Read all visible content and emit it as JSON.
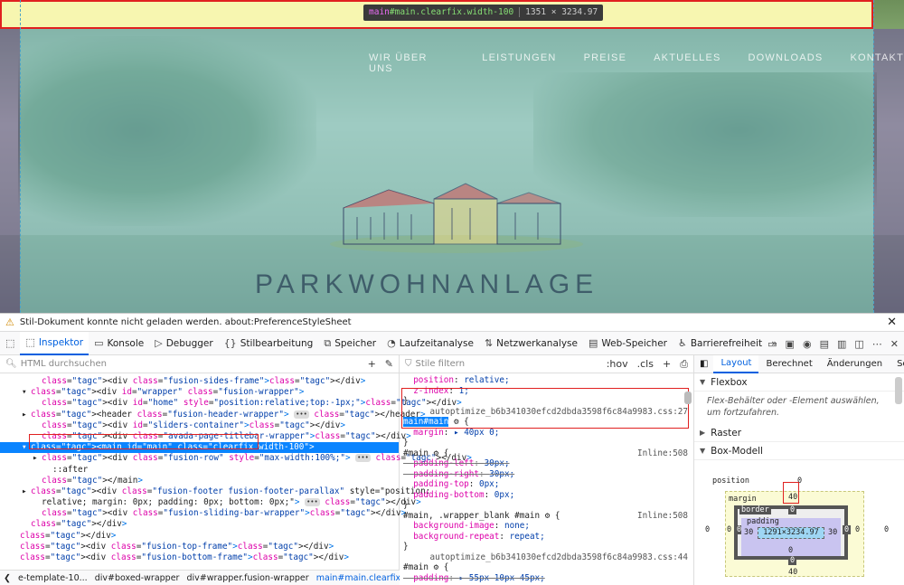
{
  "preview": {
    "tooltip": {
      "tag": "main",
      "selector": "#main.clearfix.width-100",
      "dims": "1351 × 3234.97"
    },
    "nav": [
      "WIR ÜBER UNS",
      "LEISTUNGEN",
      "PREISE",
      "AKTUELLES",
      "DOWNLOADS",
      "KONTAKT"
    ],
    "brand": "PARKWOHNANLAGE"
  },
  "notice": {
    "text": "Stil-Dokument konnte nicht geladen werden. about:PreferenceStyleSheet"
  },
  "toolbar": {
    "tabs": [
      {
        "label": "Inspektor",
        "icon": "inspector-icon"
      },
      {
        "label": "Konsole",
        "icon": "console-icon"
      },
      {
        "label": "Debugger",
        "icon": "debugger-icon"
      },
      {
        "label": "Stilbearbeitung",
        "icon": "style-editor-icon"
      },
      {
        "label": "Speicher",
        "icon": "memory-icon"
      },
      {
        "label": "Laufzeitanalyse",
        "icon": "performance-icon"
      },
      {
        "label": "Netzwerkanalyse",
        "icon": "network-icon"
      },
      {
        "label": "Web-Speicher",
        "icon": "storage-icon"
      },
      {
        "label": "Barrierefreiheit",
        "icon": "accessibility-icon"
      }
    ]
  },
  "markup": {
    "search_placeholder": "HTML durchsuchen",
    "lines": [
      {
        "indent": 2,
        "html": "<div class=\"fusion-sides-frame\"></div>"
      },
      {
        "indent": 1,
        "toggle": "▾",
        "html": "<div id=\"wrapper\" class=\"fusion-wrapper\">"
      },
      {
        "indent": 2,
        "html": "<div id=\"home\" style=\"position:relative;top:-1px;\"></div>"
      },
      {
        "indent": 1,
        "toggle": "▸",
        "html": "<header class=\"fusion-header-wrapper\"> ••• </header>"
      },
      {
        "indent": 2,
        "html": "<div id=\"sliders-container\"></div>"
      },
      {
        "indent": 2,
        "html": "<div class=\"avada-page-titlebar-wrapper\"></div>"
      },
      {
        "indent": 1,
        "toggle": "▾",
        "html": "<main id=\"main\" class=\"clearfix width-100\">",
        "selected": true
      },
      {
        "indent": 2,
        "toggle": "▸",
        "html": "<div class=\"fusion-row\" style=\"max-width:100%;\"> ••• </div>"
      },
      {
        "indent": 3,
        "html": "::after"
      },
      {
        "indent": 2,
        "html": "</main>"
      },
      {
        "indent": 1,
        "toggle": "▸",
        "html": "<div class=\"fusion-footer fusion-footer-parallax\" style=\"position:"
      },
      {
        "indent": 2,
        "html": "relative; margin: 0px; padding: 0px; bottom: 0px;\"> ••• </div>"
      },
      {
        "indent": 2,
        "html": "<div class=\"fusion-sliding-bar-wrapper\"></div>"
      },
      {
        "indent": 1,
        "html": "</div>"
      },
      {
        "indent": 0,
        "html": "</div>"
      },
      {
        "indent": 0,
        "html": "<div class=\"fusion-top-frame\"></div>"
      },
      {
        "indent": 0,
        "html": "<div class=\"fusion-bottom-frame\"></div>"
      }
    ],
    "breadcrumbs": [
      "e-template-10...",
      "div#boxed-wrapper",
      "div#wrapper.fusion-wrapper",
      "main#main.clearfix.width-100"
    ]
  },
  "rules": {
    "filter_placeholder": "Stile filtern",
    "hov": ":hov",
    "cls": ".cls",
    "lines": [
      {
        "text": "  position: relative;"
      },
      {
        "text": "  z-index: 1;"
      },
      {
        "text": "}"
      },
      {
        "text": "",
        "src": "autoptimize_b6b341030efcd2dbda3598f6c84a9983.css:27"
      },
      {
        "text": "main#main ⚙ {",
        "sel": true
      },
      {
        "text": "  margin: ▸ 40px 0;"
      },
      {
        "text": "}"
      },
      {
        "text": "#main ⚙ {",
        "src": "Inline:508"
      },
      {
        "text": "  padding-left: 30px;",
        "strike": true
      },
      {
        "text": "  padding-right: 30px;",
        "strike": true
      },
      {
        "text": "  padding-top: 0px;"
      },
      {
        "text": "  padding-bottom: 0px;"
      },
      {
        "text": "}"
      },
      {
        "text": "#main, .wrapper_blank #main ⚙ {",
        "src": "Inline:508"
      },
      {
        "text": "  background-image: none;"
      },
      {
        "text": "  background-repeat: repeat;"
      },
      {
        "text": "}"
      },
      {
        "text": "",
        "src": "autoptimize_b6b341030efcd2dbda3598f6c84a9983.css:44"
      },
      {
        "text": "#main ⚙ {"
      },
      {
        "text": "  padding: ▸ 55px 10px 45px;",
        "strike": true
      }
    ]
  },
  "layout": {
    "tabs": [
      "Layout",
      "Berechnet",
      "Änderungen",
      "Schr"
    ],
    "flexbox": {
      "title": "Flexbox",
      "note": "Flex-Behälter oder -Element auswählen, um fortzufahren."
    },
    "grid": {
      "title": "Raster"
    },
    "boxmodel": {
      "title": "Box-Modell",
      "position_label": "position",
      "position": "0",
      "margin_label": "margin",
      "margin": {
        "top": "40",
        "bottom": "40",
        "left": "0",
        "right": "0"
      },
      "border_label": "border",
      "border": {
        "top": "0",
        "bottom": "0",
        "left": "0",
        "right": "0"
      },
      "padding_label": "padding",
      "padding": {
        "top": "0",
        "bottom": "0",
        "left": "30",
        "right": "30"
      },
      "content": "1291×3234.97",
      "outer_left": "0",
      "outer_right": "0"
    }
  }
}
